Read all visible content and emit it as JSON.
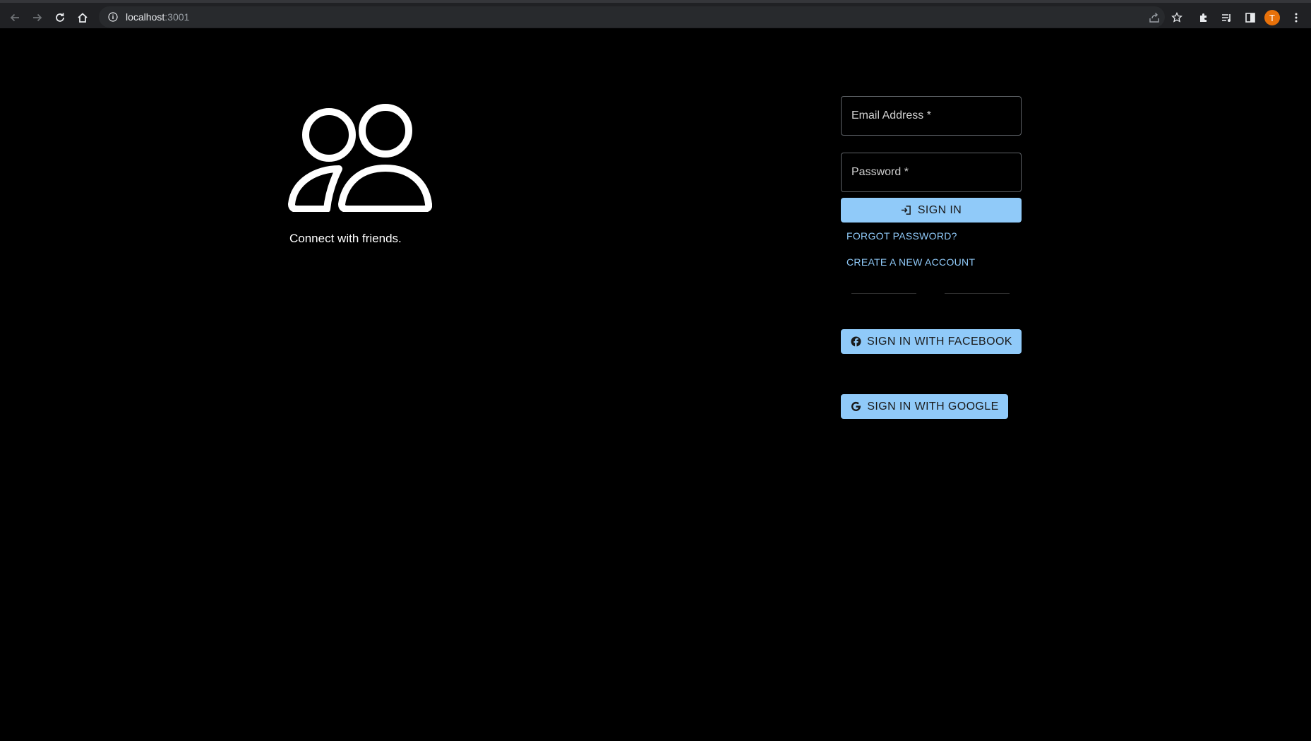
{
  "browser": {
    "url_host": "localhost",
    "url_port": ":3001",
    "profile_initial": "T",
    "profile_color": "#e8710a"
  },
  "page": {
    "logo_icon": "people-icon",
    "tagline": "Connect with friends."
  },
  "form": {
    "email_placeholder": "Email Address *",
    "password_placeholder": "Password *",
    "signin_label": "SIGN IN",
    "forgot_password_label": "FORGOT PASSWORD?",
    "create_account_label": "CREATE A NEW ACCOUNT",
    "facebook_label": "SIGN IN WITH FACEBOOK",
    "google_label": "SIGN IN WITH GOOGLE"
  },
  "colors": {
    "background": "#000000",
    "accent": "#90caf9",
    "button_text": "#1a1a1a"
  }
}
